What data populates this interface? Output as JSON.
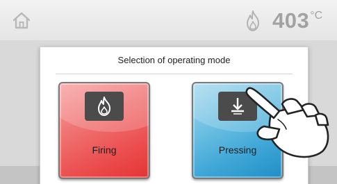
{
  "status_bar": {
    "home_icon": "home-icon",
    "temperature_icon": "flame-icon",
    "temperature_value": "403",
    "temperature_unit": "°C"
  },
  "dialog": {
    "title": "Selection of operating mode",
    "options": [
      {
        "label": "Firing",
        "icon": "flame-icon",
        "color": "#ec5050"
      },
      {
        "label": "Pressing",
        "icon": "press-down-icon",
        "color": "#3ea6d6"
      }
    ]
  },
  "overlay": {
    "icon": "pointing-hand-icon"
  },
  "colors": {
    "background": "#d9d9d9",
    "topbar": "#eeeeee",
    "temperature_text": "#a2a2a2",
    "icon_plate": "#4b4b4b"
  }
}
